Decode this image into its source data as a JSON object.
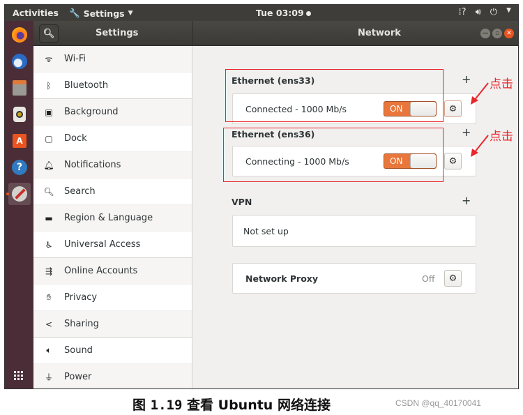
{
  "topbar": {
    "activities": "Activities",
    "app_menu": "Settings",
    "clock": "Tue 03:09",
    "tray_icons": [
      "network-unknown-icon",
      "volume-icon",
      "power-icon",
      "chevron-down-icon"
    ]
  },
  "dock": {
    "apps": [
      "firefox",
      "thunderbird",
      "files",
      "rhythmbox",
      "ubuntu-software",
      "help",
      "settings"
    ],
    "active_app": "settings"
  },
  "headerbar": {
    "left_title": "Settings",
    "title": "Network"
  },
  "sidebar": {
    "items": [
      {
        "label": "Wi-Fi",
        "icon": "wifi-icon"
      },
      {
        "label": "Bluetooth",
        "icon": "bluetooth-icon"
      },
      {
        "label": "Background",
        "icon": "background-icon"
      },
      {
        "label": "Dock",
        "icon": "dock-icon"
      },
      {
        "label": "Notifications",
        "icon": "bell-icon"
      },
      {
        "label": "Search",
        "icon": "search-icon"
      },
      {
        "label": "Region & Language",
        "icon": "region-icon"
      },
      {
        "label": "Universal Access",
        "icon": "accessibility-icon"
      },
      {
        "label": "Online Accounts",
        "icon": "online-accounts-icon"
      },
      {
        "label": "Privacy",
        "icon": "hand-icon"
      },
      {
        "label": "Sharing",
        "icon": "share-icon"
      },
      {
        "label": "Sound",
        "icon": "speaker-icon"
      },
      {
        "label": "Power",
        "icon": "power-plug-icon"
      }
    ]
  },
  "network": {
    "ethernet1": {
      "title": "Ethernet (ens33)",
      "status": "Connected - 1000 Mb/s",
      "switch": "ON"
    },
    "ethernet2": {
      "title": "Ethernet (ens36)",
      "status": "Connecting - 1000 Mb/s",
      "switch": "ON"
    },
    "vpn": {
      "title": "VPN",
      "status": "Not set up"
    },
    "proxy": {
      "title": "Network Proxy",
      "status": "Off"
    }
  },
  "annotations": {
    "click1": "点击",
    "click2": "点击",
    "color": "#e8262b"
  },
  "caption": {
    "prefix": "图",
    "number": "1.19",
    "text": "查看 Ubuntu 网络连接",
    "watermark": "CSDN @qq_40170041"
  }
}
